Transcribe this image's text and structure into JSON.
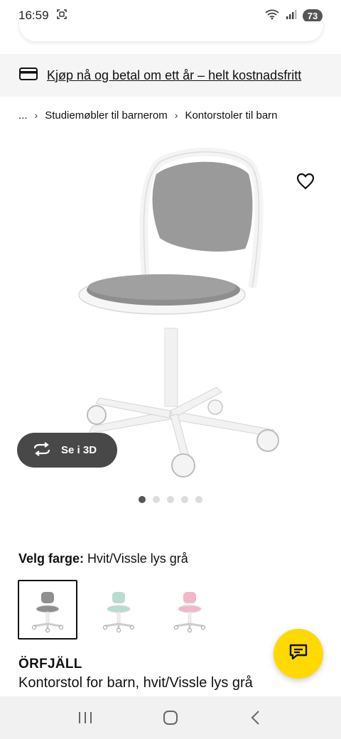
{
  "status": {
    "time": "16:59",
    "battery": "73",
    "icons": [
      "screenshot-icon",
      "wifi-icon",
      "signal-icon"
    ]
  },
  "promo": {
    "icon": "credit-card-icon",
    "text": "Kjøp nå og betal om ett år – helt kostnadsfritt"
  },
  "breadcrumb": {
    "ellipsis": "...",
    "items": [
      "Studiemøbler til barnerom",
      "Kontorstoler til barn"
    ]
  },
  "gallery": {
    "view3d_label": "Se i 3D",
    "dot_count": 5,
    "active_dot": 1,
    "favorite_icon": "heart-outline-icon"
  },
  "color_picker": {
    "label": "Velg farge:",
    "selected": "Hvit/Vissle lys grå",
    "swatches": [
      {
        "name": "grey",
        "seat_color": "#8f8f8f",
        "selected": true
      },
      {
        "name": "mint",
        "seat_color": "#b9dcd0",
        "selected": false
      },
      {
        "name": "pink",
        "seat_color": "#f2b7c8",
        "selected": false
      }
    ]
  },
  "product": {
    "name": "ÖRFJÄLL",
    "description": "Kontorstol for barn, hvit/Vissle lys grå"
  },
  "colors": {
    "accent_yellow": "#ffd900",
    "dark_pill": "#484848"
  }
}
